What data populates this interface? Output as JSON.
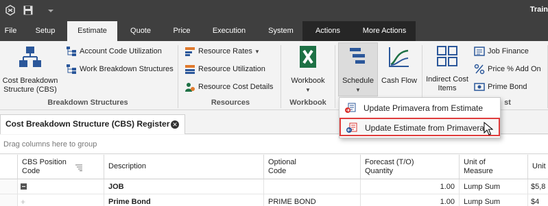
{
  "app": {
    "name": "Train"
  },
  "menu": [
    "File",
    "Setup",
    "Estimate",
    "Quote",
    "Price",
    "Execution",
    "System",
    "Actions",
    "More Actions"
  ],
  "ribbon": {
    "breakdown": {
      "label": "Breakdown Structures",
      "cbs": "Cost Breakdown Structure (CBS)",
      "account_code": "Account Code Utilization",
      "wbs": "Work Breakdown Structures"
    },
    "resources": {
      "label": "Resources",
      "rates": "Resource Rates",
      "utilization": "Resource Utilization",
      "cost_details": "Resource Cost Details"
    },
    "workbook": {
      "label": "Workbook",
      "button": "Workbook"
    },
    "schedule": {
      "button": "Schedule",
      "cash_flow": "Cash Flow"
    },
    "indirect": {
      "button": "Indirect Cost Items",
      "job_finance": "Job Finance",
      "price_add_on": "Price % Add On",
      "prime_bond": "Prime Bond",
      "label_tail": "st"
    }
  },
  "dropdown": {
    "items": [
      "Update Primavera from Estimate",
      "Update Estimate from Primavera"
    ]
  },
  "tab": {
    "title": "Cost Breakdown Structure (CBS) Register"
  },
  "group_panel": "Drag columns here to group",
  "grid": {
    "headers": [
      "CBS Position Code",
      "Description",
      "Optional Code",
      "Forecast (T/O) Quantity",
      "Unit of Measure",
      "Unit"
    ],
    "rows": [
      {
        "description": "JOB",
        "optional_code": "",
        "quantity": "1.00",
        "uom": "Lump Sum",
        "unit": "$5,8"
      },
      {
        "description": "Prime Bond",
        "optional_code": "PRIME BOND",
        "quantity": "1.00",
        "uom": "Lump Sum",
        "unit": "$4"
      }
    ]
  },
  "colors": {
    "accent_blue": "#2b579a",
    "excel_green": "#1e7145",
    "highlight_red": "#e03c3c",
    "dark_bar": "#3f3f3f"
  }
}
